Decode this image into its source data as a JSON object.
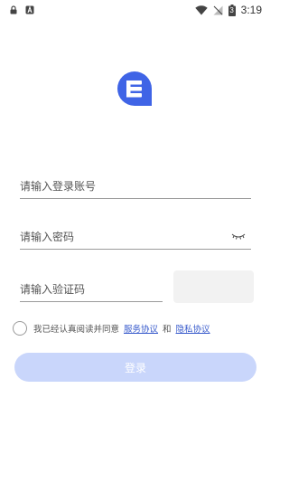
{
  "status_bar": {
    "time": "3:19",
    "battery_level": "3",
    "left_icons": [
      "lock-icon",
      "a-icon"
    ],
    "right_icons": [
      "wifi-icon",
      "no-signal-icon",
      "battery-icon"
    ]
  },
  "brand": {
    "logo_icon": "chat-e-logo",
    "accent_color": "#3f64e6"
  },
  "form": {
    "account_placeholder": "请输入登录账号",
    "password_placeholder": "请输入密码",
    "code_placeholder": "请输入验证码",
    "password_toggle_icon": "eye-closed-icon"
  },
  "agreement": {
    "prefix": "我已经认真阅读并同意",
    "service_link": "服务协议",
    "and": "和",
    "privacy_link": "隐私协议"
  },
  "login": {
    "label": "登录",
    "color": "#c9d6fb"
  }
}
